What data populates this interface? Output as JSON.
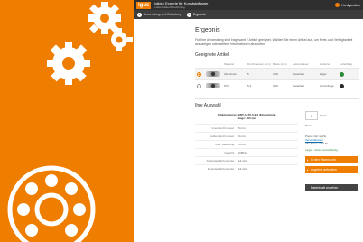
{
  "app": {
    "logo": "igus",
    "title": "iglidur Experte für Kunststofflager",
    "subtitle": "Lebensdauerberechnung",
    "config_label": "Konfiguration"
  },
  "steps": [
    {
      "num": "1",
      "label": "Anwendung und Belastung"
    },
    {
      "num": "2",
      "label": "Ergebnis"
    }
  ],
  "content": {
    "title": "Ergebnis",
    "intro": "Für Ihre Anwendung sind insgesamt 2 Artikel geeignet. Wählen Sie einen Artikel aus, um Preis und Verfügbarkeit anzuzeigen oder weitere Informationen abzurufen.",
    "suitable_heading": "Geeignete Artikel",
    "table": {
      "headers": [
        "",
        "",
        "Material",
        "Durchmesser (mm)",
        "Breite (mm)",
        "Lebensdauer",
        "Lieferzeit",
        "Lieferfähig"
      ],
      "rows": [
        {
          "selected": true,
          "material": "Aluminium",
          "diameter": "5",
          "width": "3.00",
          "life": "Dauerfest",
          "delivery": "Lager",
          "ok_color": "#2e8b3a"
        },
        {
          "selected": false,
          "material": "PVC",
          "diameter": "5,2",
          "width": "3.00",
          "life": "Dauerfest",
          "delivery": "Auf Anfrage",
          "ok_color": "#2b2b2b"
        }
      ]
    },
    "selection_heading": "Ihre Auswahl",
    "spec": {
      "head_line1": "Artikelnummer: BRT-AL55-5-9-3 (Einzelstück)",
      "head_line2": "Länge: 300 mm",
      "lines": [
        {
          "label": "Innendurchmesser:",
          "value": "5 mm"
        },
        {
          "label": "Außendurchmesser:",
          "value": "9 mm"
        },
        {
          "label": "Max. Belastung:",
          "value": "5 mm"
        },
        {
          "label": "Gewicht:",
          "value": "0.88 kg"
        },
        {
          "label": "Außenlaufflächenbreite:",
          "value": "12 mm"
        },
        {
          "label": "Innenlaufflächenbreite:",
          "value": "12 mm"
        }
      ]
    },
    "shop": {
      "qty": "1",
      "unit": "Stück",
      "price_label": "Preis",
      "tax_note": "Preise inkl. MwSt.",
      "shipping_link": "Versandkosten",
      "currency_note": "Alle Preise in EUR",
      "stock": "Lager - direkt versandfertig",
      "cart_button": "In den Warenkorb",
      "pdf_button": "Angebot anfordern",
      "dark_button": "Datenblatt ansehen"
    }
  }
}
